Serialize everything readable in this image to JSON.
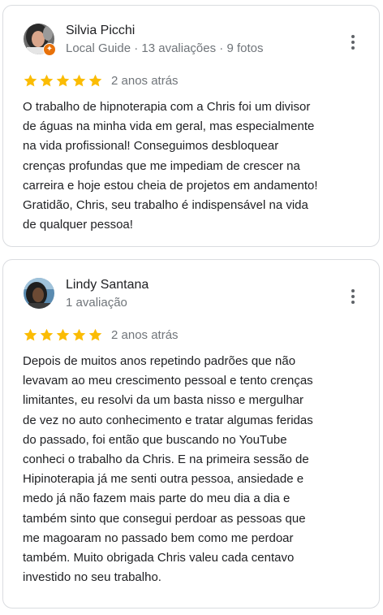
{
  "reviews": [
    {
      "author": "Silvia Picchi",
      "meta": "Local Guide · 13 avaliações · 9 fotos",
      "rating": 5,
      "date": "2 anos atrás",
      "text": "O trabalho de hipnoterapia com a Chris foi um divisor\nde águas na minha vida em geral, mas especialmente\nna vida profissional! Conseguimos desbloquear\ncrenças profundas que me impediam de crescer na\ncarreira e hoje estou cheia de projetos em andamento!\nGratidão, Chris, seu trabalho é indispensável na vida\nde qualquer pessoa!",
      "local_guide_badge": true
    },
    {
      "author": "Lindy Santana",
      "meta": "1 avaliação",
      "rating": 5,
      "date": "2 anos atrás",
      "text": "Depois de muitos anos repetindo padrões que não\nlevavam ao meu crescimento pessoal e tento crenças\nlimitantes,  eu resolvi da um basta nisso e mergulhar\nde vez no auto conhecimento e tratar algumas feridas\ndo passado, foi então que buscando no YouTube\nconheci o trabalho da Chris. E na primeira sessão de\nHipinoterapia já me senti outra pessoa, ansiedade e\nmedo já não fazem mais parte do meu dia a dia e\ntambém sinto que consegui perdoar as pessoas que\nme magoaram no passado bem como me perdoar\ntambém. Muito obrigada Chris valeu cada centavo\ninvestido no seu  trabalho.",
      "local_guide_badge": false
    }
  ],
  "colors": {
    "star": "#fbbc04",
    "badge": "#e8710a",
    "border": "#dadce0",
    "secondary_text": "#70757a"
  },
  "icons": {
    "rating": "star-icon",
    "menu": "more-vert-icon",
    "badge": "local-guide-badge-icon"
  }
}
